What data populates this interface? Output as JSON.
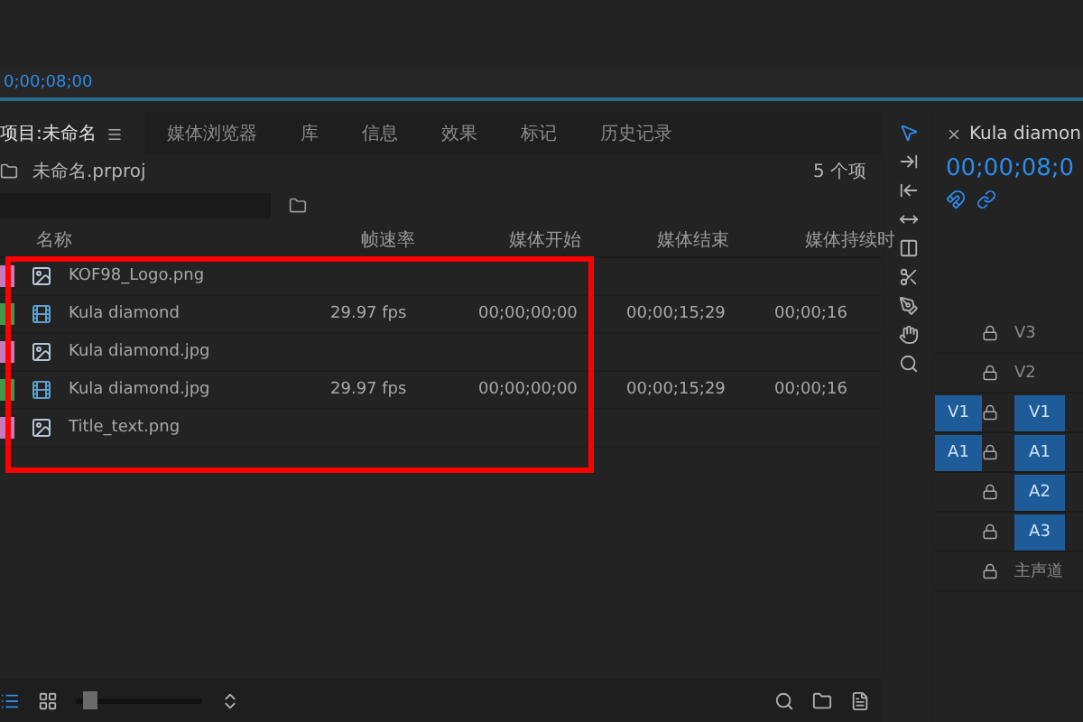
{
  "viewer": {
    "timecode": "0;00;08;00"
  },
  "project_panel": {
    "tabs": [
      {
        "label": "项目:未命名",
        "selected": true
      },
      {
        "label": "媒体浏览器",
        "selected": false
      },
      {
        "label": "库",
        "selected": false
      },
      {
        "label": "信息",
        "selected": false
      },
      {
        "label": "效果",
        "selected": false
      },
      {
        "label": "标记",
        "selected": false
      },
      {
        "label": "历史记录",
        "selected": false
      }
    ],
    "file": "未命名.prproj",
    "item_count": "5 个项",
    "columns": [
      "名称",
      "帧速率",
      "媒体开始",
      "媒体结束",
      "媒体持续时"
    ],
    "rows": [
      {
        "kind": "image",
        "color": "#c77bbd",
        "name": "KOF98_Logo.png"
      },
      {
        "kind": "sequence",
        "color": "#3f9a4c",
        "name": "Kula diamond",
        "frame_rate": "29.97 fps",
        "media_start": "00;00;00;00",
        "media_end": "00;00;15;29",
        "duration": "00;00;16"
      },
      {
        "kind": "image",
        "color": "#c77bbd",
        "name": "Kula diamond.jpg"
      },
      {
        "kind": "sequence",
        "color": "#3f9a4c",
        "name": "Kula diamond.jpg",
        "frame_rate": "29.97 fps",
        "media_start": "00;00;00;00",
        "media_end": "00;00;15;29",
        "duration": "00;00;16"
      },
      {
        "kind": "image",
        "color": "#c77bbd",
        "name": "Title_text.png"
      }
    ],
    "zoom": {
      "level": 0.05
    }
  },
  "timeline": {
    "title": "Kula diamon",
    "timecode": "00;00;08;0",
    "tracks": [
      {
        "label": "V3",
        "targeted": false
      },
      {
        "label": "V2",
        "targeted": false
      },
      {
        "source": "V1",
        "label": "V1",
        "targeted": true
      },
      {
        "source": "A1",
        "label": "A1",
        "targeted": true
      },
      {
        "label": "A2",
        "targeted": true
      },
      {
        "label": "A3",
        "targeted": true
      },
      {
        "label": "主声道",
        "targeted": false
      }
    ]
  }
}
